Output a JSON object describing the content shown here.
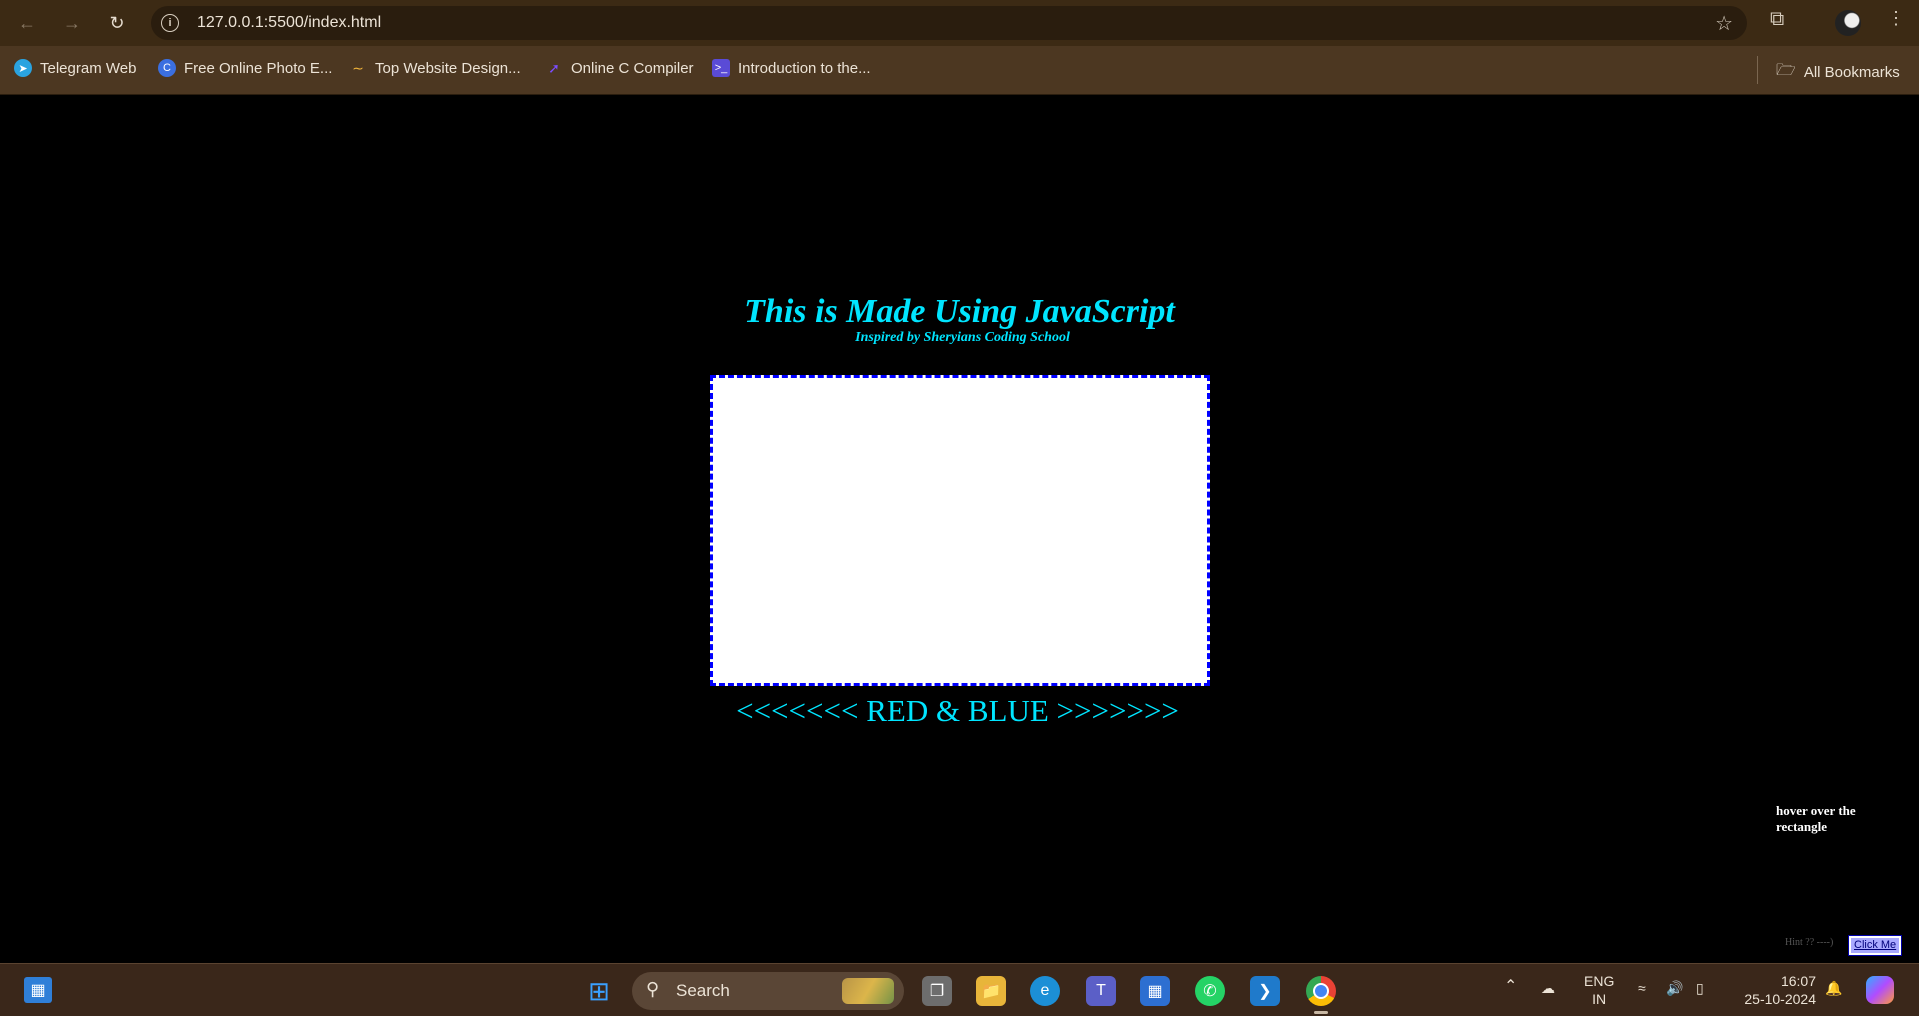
{
  "browser": {
    "url": "127.0.0.1:5500/index.html",
    "bookmarks": [
      {
        "label": "Telegram Web",
        "icon": "telegram-icon",
        "color": "#2aa3e0"
      },
      {
        "label": "Free Online Photo E...",
        "icon": "canva-icon",
        "color": "#3b6fe0"
      },
      {
        "label": "Top Website Design...",
        "icon": "wave-icon",
        "color": "#f2b53a"
      },
      {
        "label": "Online C Compiler",
        "icon": "compiler-icon",
        "color": "#7b4dff"
      },
      {
        "label": "Introduction to the...",
        "icon": "terminal-icon",
        "color": "#5a4bd6"
      }
    ],
    "all_bookmarks_label": "All Bookmarks"
  },
  "page": {
    "title": "This is Made Using JavaScript",
    "subtitle": "Inspired by Sheryians Coding School",
    "caption": "<<<<<<< RED & BLUE >>>>>>>",
    "hover_note": "hover over the rectangle",
    "hint": "Hint ?? ----)",
    "click_me_label": "Click Me",
    "colors": {
      "accent": "#00e5ff",
      "rect_border": "#0000ff",
      "background": "#000000"
    }
  },
  "taskbar": {
    "search_label": "Search",
    "language": "ENG",
    "region": "IN",
    "time": "16:07",
    "date": "25-10-2024"
  }
}
